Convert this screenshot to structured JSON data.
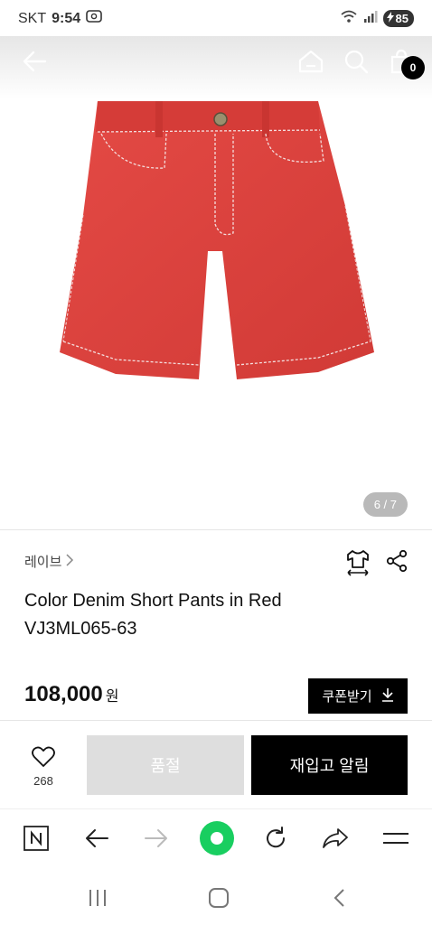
{
  "status_bar": {
    "carrier": "SKT",
    "time": "9:54",
    "battery": "85"
  },
  "gallery": {
    "pager": "6 / 7",
    "cart_count": "0",
    "product_color": "#e0423f"
  },
  "product": {
    "brand": "레이브",
    "title_line1": "Color Denim Short Pants in Red",
    "title_line2": "VJ3ML065-63",
    "price": "108,000",
    "currency": "원",
    "coupon_label": "쿠폰받기"
  },
  "actions": {
    "like_count": "268",
    "soldout_label": "품절",
    "restock_label": "재입고 알림"
  },
  "browser_bar": {
    "icons": [
      "naver-icon",
      "back-arrow-icon",
      "forward-arrow-icon",
      "home-circle-icon",
      "refresh-icon",
      "share-icon",
      "menu-icon"
    ],
    "accent": "#19ce60"
  },
  "nav_bar": {
    "icons": [
      "recent-apps-icon",
      "home-icon",
      "back-icon"
    ]
  }
}
